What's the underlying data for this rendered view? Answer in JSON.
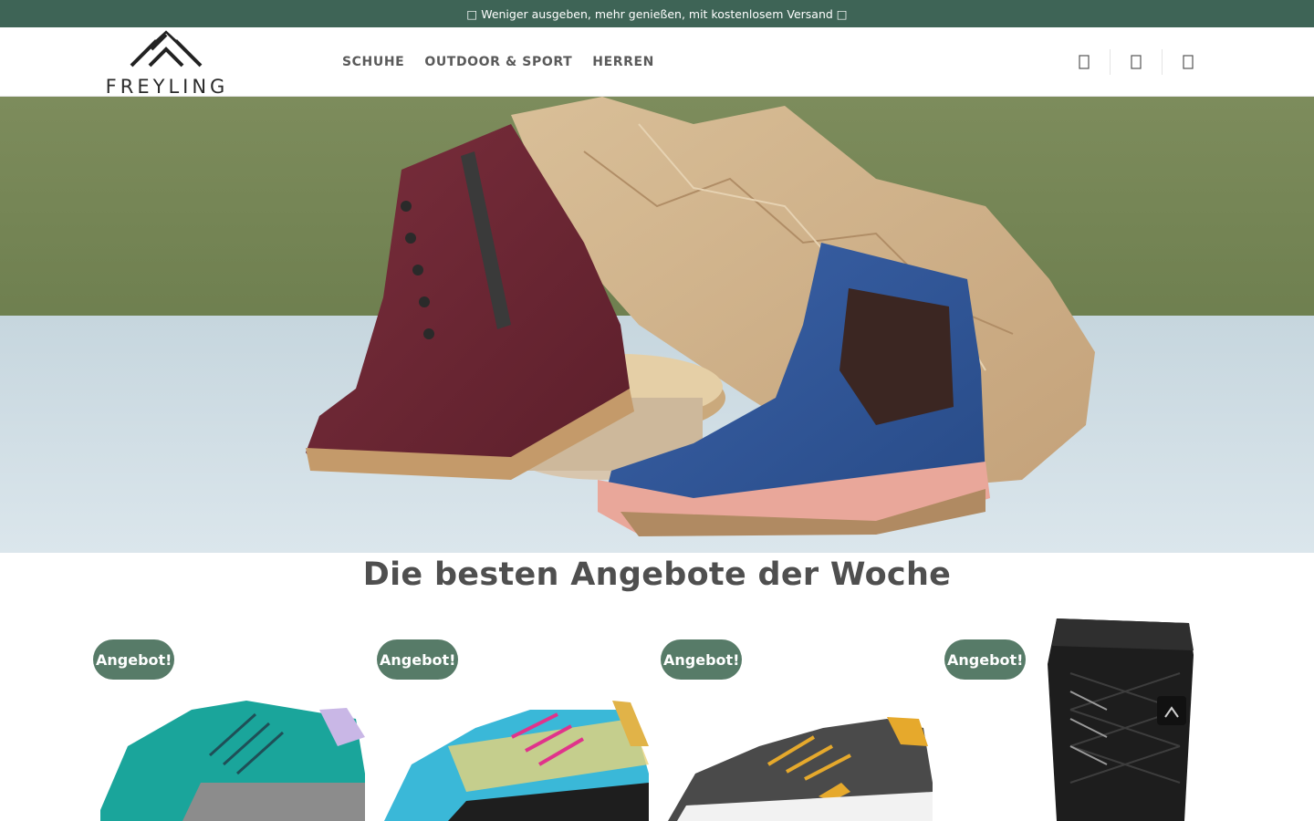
{
  "announcement": {
    "text": "□ Weniger ausgeben, mehr genießen, mit kostenlosem Versand □"
  },
  "header": {
    "logo_text": "FREYLING",
    "nav": [
      {
        "label": "SCHUHE"
      },
      {
        "label": "OUTDOOR & SPORT"
      },
      {
        "label": "HERREN"
      }
    ],
    "icons": [
      "search-icon",
      "account-icon",
      "cart-icon"
    ]
  },
  "hero": {
    "image": "burgundy-lace-up-boot-and-blue-chelsea-boot-on-wood-slices"
  },
  "deals": {
    "title": "Die besten Angebote der Woche",
    "products": [
      {
        "badge": "Angebot!",
        "image": "teal-sneaker"
      },
      {
        "badge": "Angebot!",
        "image": "turquoise-pink-trail-shoe"
      },
      {
        "badge": "Angebot!",
        "image": "grey-orange-knit-sneaker"
      },
      {
        "badge": "Angebot!",
        "image": "black-quilted-winter-boot"
      }
    ]
  },
  "colors": {
    "topbar": "#3e6456",
    "badge": "#577b68",
    "nav_text": "#5a5a5a"
  }
}
